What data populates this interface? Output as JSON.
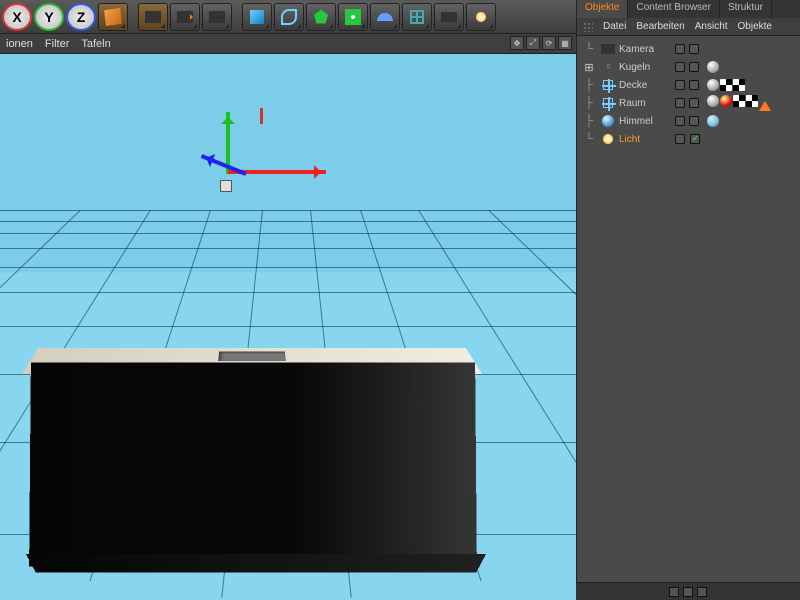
{
  "toolbar": {
    "axes": [
      "X",
      "Y",
      "Z"
    ],
    "axis_colors": [
      "#dd3030",
      "#2bbb2b",
      "#2b5bdd"
    ]
  },
  "menus": {
    "items": [
      "ionen",
      "Filter",
      "Tafeln"
    ]
  },
  "panel": {
    "tabs": [
      "Objekte",
      "Content Browser",
      "Struktur"
    ],
    "active_tab": 0,
    "menu": [
      "Datei",
      "Bearbeiten",
      "Ansicht",
      "Objekte"
    ]
  },
  "objects": [
    {
      "name": "Kamera",
      "icon": "camera",
      "indent": 0,
      "tags": [],
      "selected": false
    },
    {
      "name": "Kugeln",
      "icon": "null",
      "indent": 0,
      "expand": "+",
      "frame": "0",
      "tags": [
        "sphere"
      ],
      "selected": false
    },
    {
      "name": "Decke",
      "icon": "null",
      "indent": 0,
      "tags": [
        "sphere",
        "check",
        "check"
      ],
      "selected": false
    },
    {
      "name": "Raum",
      "icon": "null",
      "indent": 0,
      "tags": [
        "sphere",
        "red",
        "check",
        "check",
        "tri"
      ],
      "selected": false
    },
    {
      "name": "Himmel",
      "icon": "sky",
      "indent": 0,
      "tags": [
        "sky"
      ],
      "selected": false
    },
    {
      "name": "Licht",
      "icon": "light",
      "indent": 0,
      "tags": [],
      "selected": true,
      "enabled": true
    }
  ]
}
